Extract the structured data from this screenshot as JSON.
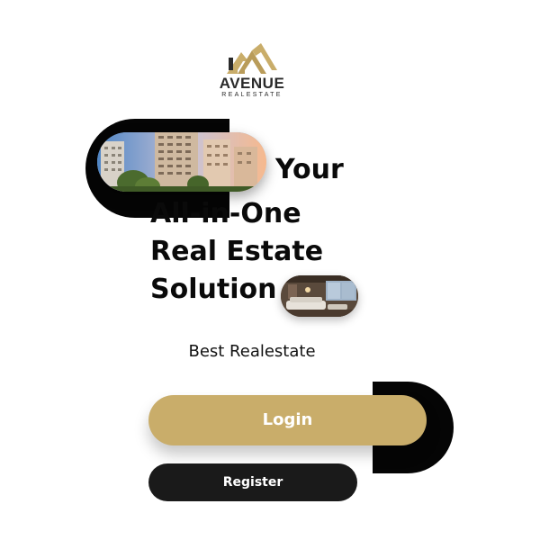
{
  "logo": {
    "wordmark": "AVENUE",
    "subtitle": "REALESTATE",
    "icon": "house-roofs-icon",
    "color": "#c9ad6a"
  },
  "hero": {
    "line1": "Your",
    "line2": "All-in-One",
    "line3": "Real Estate",
    "line4": "Solution",
    "building_image": "apartment-buildings-photo",
    "interior_image": "living-room-interior-photo"
  },
  "subtitle": "Best Realestate",
  "actions": {
    "login_label": "Login",
    "register_label": "Register"
  },
  "colors": {
    "accent": "#c9ad6a",
    "dark": "#1a1a1a",
    "background": "#ffffff"
  }
}
